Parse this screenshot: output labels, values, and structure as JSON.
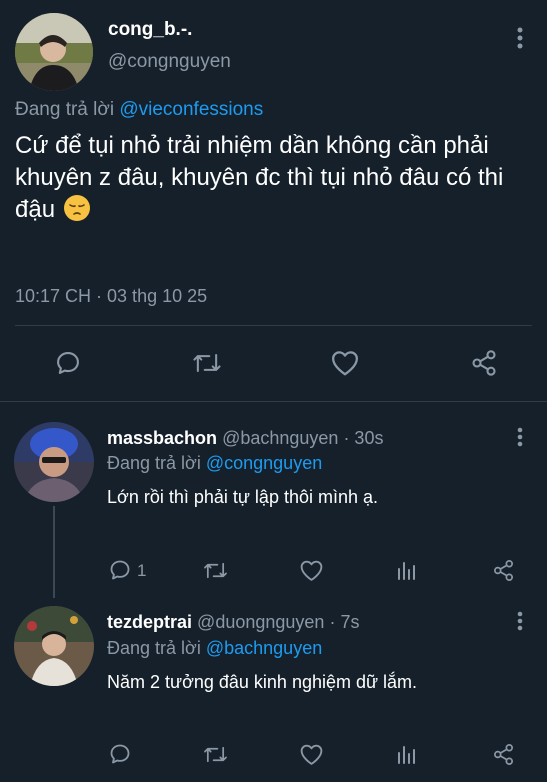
{
  "main_tweet": {
    "display_name": "cong_b.-.",
    "handle": "@congnguyen",
    "reply_prefix": "Đang trả lời",
    "reply_to": "@vieconfessions",
    "text": "Cứ để tụi nhỏ trải nhiệm dần không cần phải khuyên z đâu, khuyên đc thì tụi nhỏ đâu có thi đậu",
    "emoji": "pensive-face-emoji",
    "timestamp": "10:17 CH · 03 thg 10 25"
  },
  "replies": [
    {
      "display_name": "massbachon",
      "handle": "@bachnguyen",
      "time": "· 30s",
      "reply_prefix": "Đang trả lời",
      "reply_to": "@congnguyen",
      "text": "Lớn rồi thì phải tự lập thôi mình ạ.",
      "reply_count": "1"
    },
    {
      "display_name": "tezdeptrai",
      "handle": "@duongnguyen",
      "time": "· 7s",
      "reply_prefix": "Đang trả lời",
      "reply_to": "@bachnguyen",
      "text": "Năm 2 tưởng đâu kinh nghiệm dữ lắm."
    }
  ],
  "colors": {
    "background": "#15202b",
    "muted": "#8b98a5",
    "accent": "#1d9bf0",
    "divider": "#2f3b47"
  }
}
